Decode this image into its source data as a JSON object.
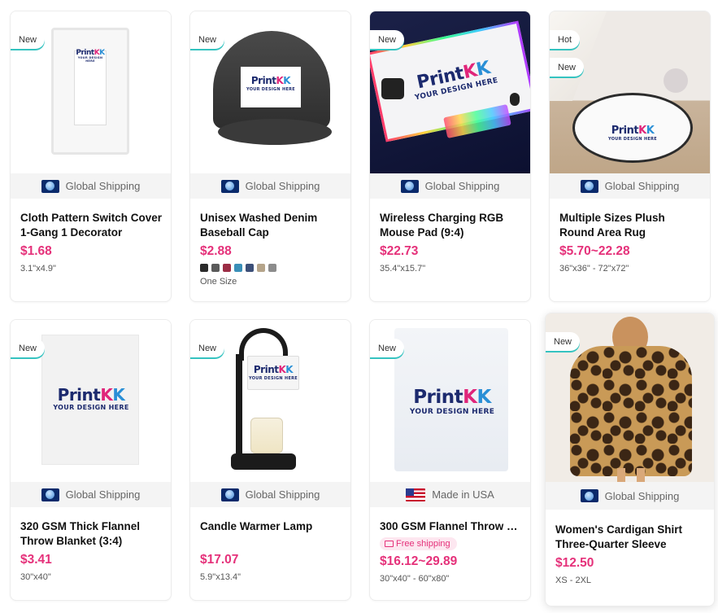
{
  "shipping": {
    "global_label": "Global Shipping",
    "usa_label": "Made in USA",
    "free_label": "Free shipping"
  },
  "logo": {
    "print": "Print",
    "k": "K",
    "tagline": "YOUR DESIGN HERE"
  },
  "products": [
    {
      "badges": [
        "New"
      ],
      "title": "Cloth Pattern Switch Cover 1-Gang 1 Decorator",
      "price": "$1.68",
      "size": "3.1\"x4.9\""
    },
    {
      "badges": [
        "New"
      ],
      "title": "Unisex Washed Denim Baseball Cap",
      "price": "$2.88",
      "size": "One Size",
      "swatches": [
        "#2b2b2b",
        "#5a5a5a",
        "#9b2d45",
        "#3a8fb8",
        "#3c4f78",
        "#b5a48a",
        "#8c8c8c"
      ]
    },
    {
      "badges": [
        "New"
      ],
      "title": "Wireless Charging RGB Mouse Pad (9:4)",
      "price": "$22.73",
      "size": "35.4\"x15.7\""
    },
    {
      "badges": [
        "Hot",
        "New"
      ],
      "title": "Multiple Sizes Plush Round Area Rug",
      "price": "$5.70~22.28",
      "size": "36\"x36\" - 72\"x72\""
    },
    {
      "badges": [
        "New"
      ],
      "title": "320 GSM Thick Flannel Throw Blanket (3:4)",
      "price": "$3.41",
      "size": "30\"x40\""
    },
    {
      "badges": [
        "New"
      ],
      "title": "Candle Warmer Lamp",
      "price": "$17.07",
      "size": "5.9\"x13.4\""
    },
    {
      "badges": [
        "New"
      ],
      "title": "300 GSM Flannel Throw B...",
      "price": "$16.12~29.89",
      "size": "30\"x40\" - 60\"x80\""
    },
    {
      "badges": [
        "New"
      ],
      "title": "Women's Cardigan Shirt Three-Quarter Sleeve",
      "price": "$12.50",
      "size": "XS - 2XL"
    }
  ],
  "colors": {
    "price": "#e5317a",
    "badge_underline": "#35c3c0"
  }
}
